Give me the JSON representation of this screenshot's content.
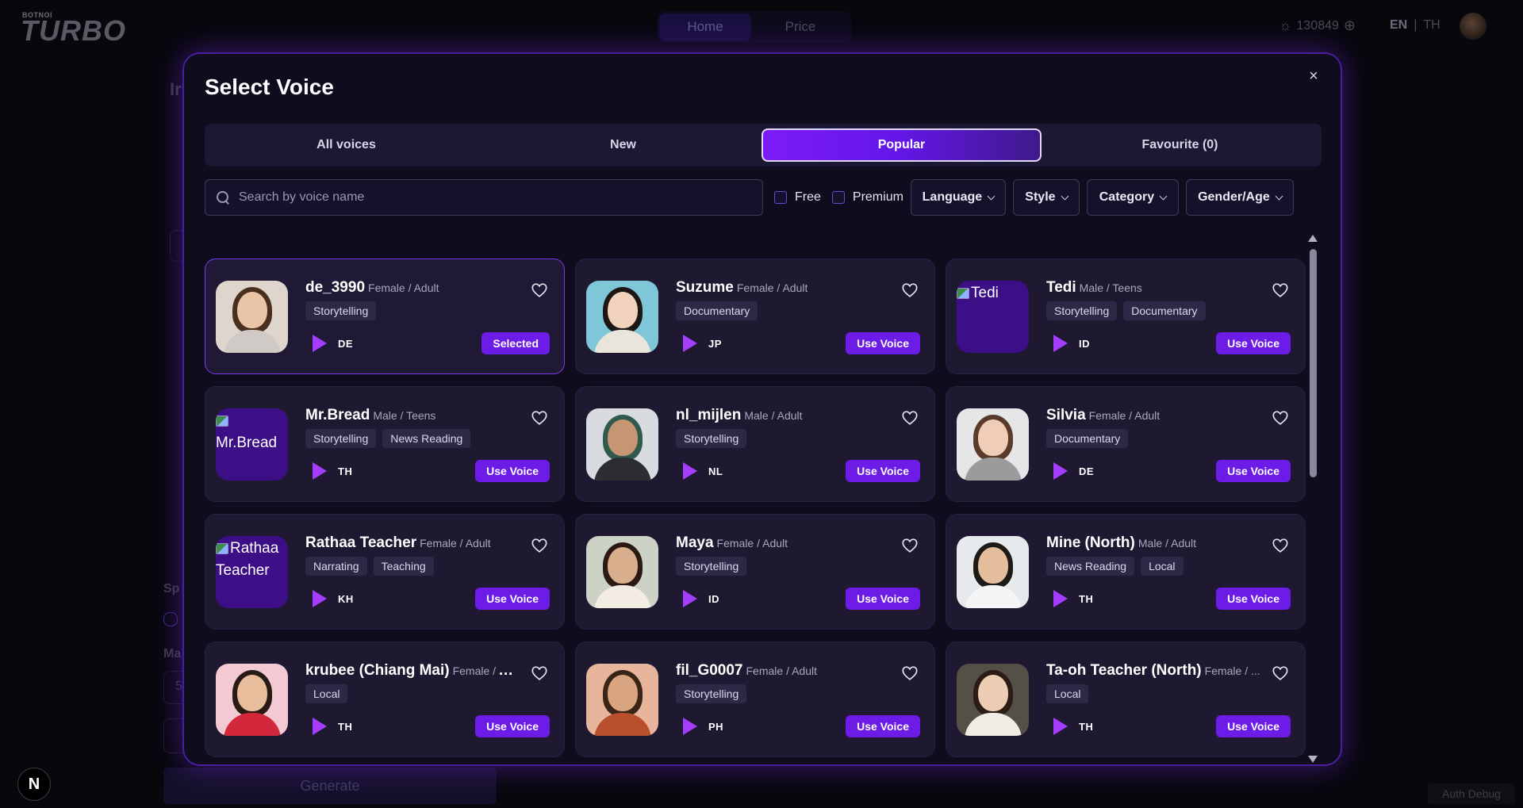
{
  "app": {
    "logo_small": "BOTNOI",
    "logo_big": "TURBO",
    "nav": {
      "home": "Home",
      "price": "Price"
    },
    "credits": "130849",
    "lang_en": "EN",
    "lang_sep": "|",
    "lang_th": "TH",
    "generate_label": "Generate",
    "auth_debug": "Auth Debug",
    "n_badge": "N",
    "bg_text_1": "Ir",
    "bg_text_2": "Sp",
    "bg_text_3": "Ma",
    "bg_text_4": "5"
  },
  "modal": {
    "title": "Select Voice",
    "close": "×",
    "tabs": [
      {
        "label": "All voices",
        "active": false
      },
      {
        "label": "New",
        "active": false
      },
      {
        "label": "Popular",
        "active": true
      },
      {
        "label": "Favourite (0)",
        "active": false
      }
    ],
    "search_placeholder": "Search by voice name",
    "filters": {
      "free": "Free",
      "premium": "Premium",
      "language": "Language",
      "style": "Style",
      "category": "Category",
      "gender_age": "Gender/Age"
    },
    "voices": [
      {
        "name": "de_3990",
        "meta": "Female / Adult",
        "tags": [
          "Storytelling"
        ],
        "lang": "DE",
        "button": "Selected",
        "selected": true,
        "image": "photo"
      },
      {
        "name": "Suzume",
        "meta": "Female / Adult",
        "tags": [
          "Documentary"
        ],
        "lang": "JP",
        "button": "Use Voice",
        "selected": false,
        "image": "photo"
      },
      {
        "name": "Tedi",
        "meta": "Male / Teens",
        "tags": [
          "Storytelling",
          "Documentary"
        ],
        "lang": "ID",
        "button": "Use Voice",
        "selected": false,
        "image": "broken",
        "alt": "Tedi"
      },
      {
        "name": "Mr.Bread",
        "meta": "Male / Teens",
        "tags": [
          "Storytelling",
          "News Reading"
        ],
        "lang": "TH",
        "button": "Use Voice",
        "selected": false,
        "image": "broken",
        "alt": "Mr.Bread"
      },
      {
        "name": "nl_mijlen",
        "meta": "Male / Adult",
        "tags": [
          "Storytelling"
        ],
        "lang": "NL",
        "button": "Use Voice",
        "selected": false,
        "image": "photo"
      },
      {
        "name": "Silvia",
        "meta": "Female / Adult",
        "tags": [
          "Documentary"
        ],
        "lang": "DE",
        "button": "Use Voice",
        "selected": false,
        "image": "photo"
      },
      {
        "name": "Rathaa Teacher",
        "meta": "Female / Adult",
        "tags": [
          "Narrating",
          "Teaching"
        ],
        "lang": "KH",
        "button": "Use Voice",
        "selected": false,
        "image": "broken",
        "alt": "Rathaa Teacher"
      },
      {
        "name": "Maya",
        "meta": "Female / Adult",
        "tags": [
          "Storytelling"
        ],
        "lang": "ID",
        "button": "Use Voice",
        "selected": false,
        "image": "photo"
      },
      {
        "name": "Mine (North)",
        "meta": "Male / Adult",
        "tags": [
          "News Reading",
          "Local"
        ],
        "lang": "TH",
        "button": "Use Voice",
        "selected": false,
        "image": "photo"
      },
      {
        "name": "krubee (Chiang Mai)",
        "meta": "Female / Adult",
        "tags": [
          "Local"
        ],
        "lang": "TH",
        "button": "Use Voice",
        "selected": false,
        "image": "photo"
      },
      {
        "name": "fil_G0007",
        "meta": "Female / Adult",
        "tags": [
          "Storytelling"
        ],
        "lang": "PH",
        "button": "Use Voice",
        "selected": false,
        "image": "photo"
      },
      {
        "name": "Ta-oh Teacher (North)",
        "meta": "Female / ...",
        "tags": [
          "Local"
        ],
        "lang": "TH",
        "button": "Use Voice",
        "selected": false,
        "image": "photo"
      }
    ]
  },
  "colors": {
    "accent": "#6c1ce6",
    "play": "#a53dff",
    "modal_border": "#4b1e9e",
    "card_bg": "#1e1931"
  },
  "icons": {
    "close": "close-icon",
    "search": "search-icon",
    "heart": "heart-icon",
    "play": "play-icon",
    "chevron": "chevron-down-icon",
    "credits": "sun-icon",
    "add": "plus-circle-icon"
  }
}
